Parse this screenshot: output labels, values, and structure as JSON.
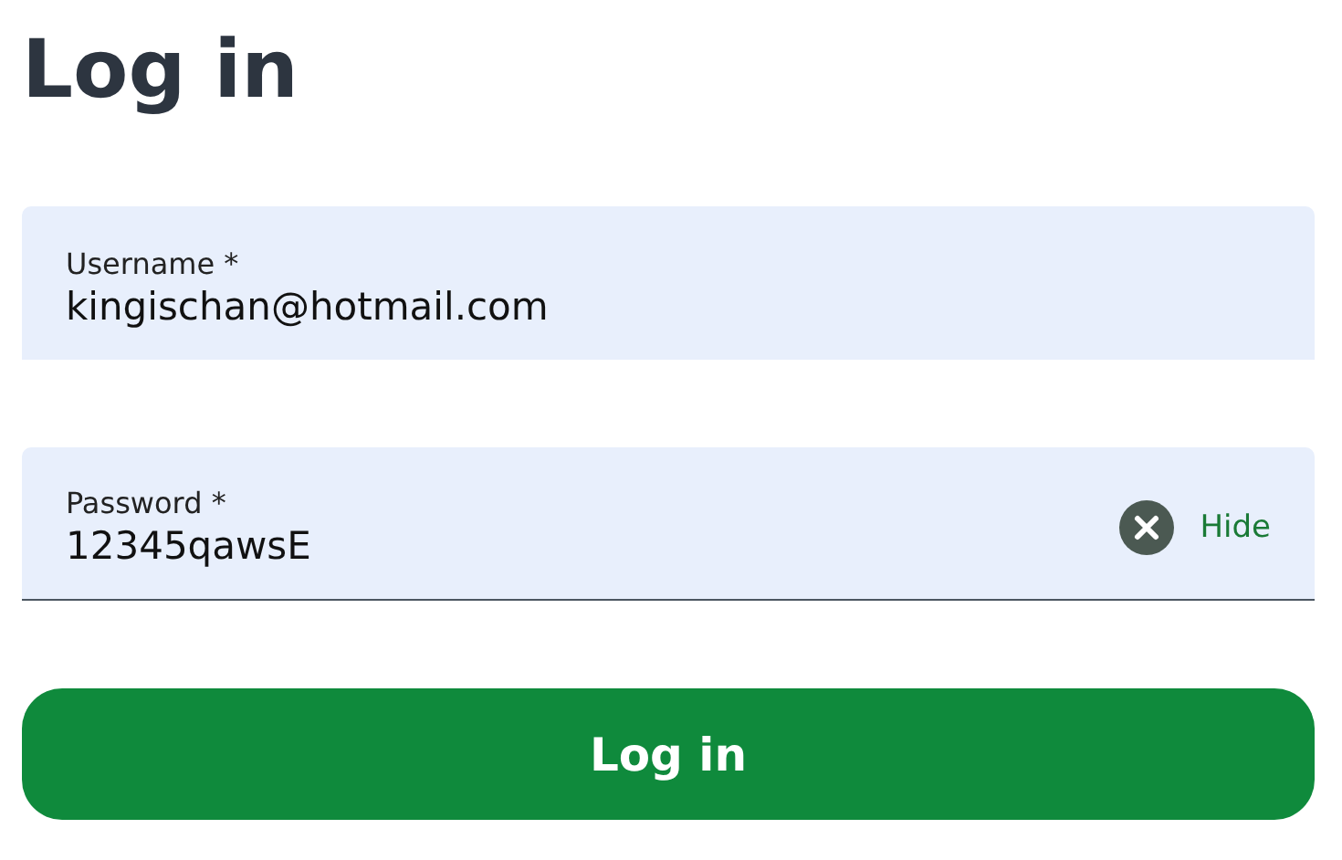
{
  "title": "Log in",
  "fields": [
    {
      "kind": "text",
      "label": "Username",
      "required_mark": "*",
      "value": "kingischan@hotmail.com",
      "focused": false
    },
    {
      "kind": "password",
      "label": "Password",
      "required_mark": "*",
      "value": "12345qawsE",
      "focused": true,
      "toggle": "Hide"
    }
  ],
  "submit": "Log in"
}
